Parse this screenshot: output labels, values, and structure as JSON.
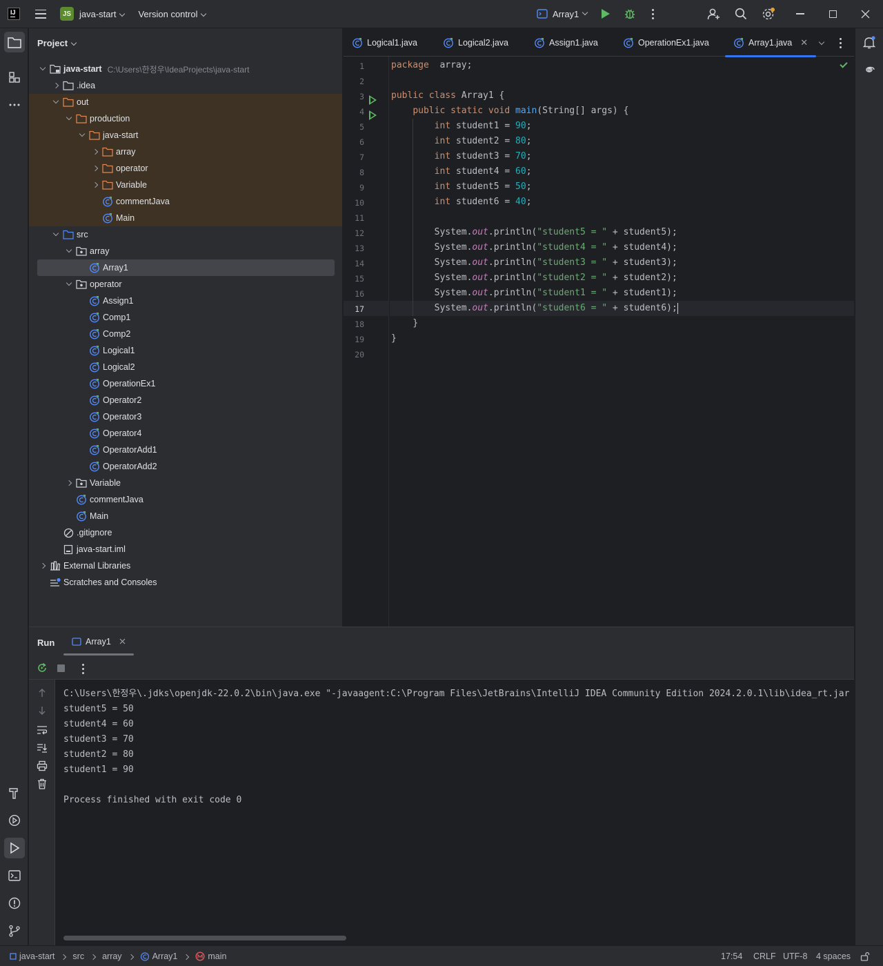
{
  "titlebar": {
    "project_badge": "JS",
    "project_name": "java-start",
    "vcs": "Version control",
    "run_config": "Array1"
  },
  "project_panel": {
    "title": "Project",
    "root_name": "java-start",
    "root_path": "C:\\Users\\한정우\\IdeaProjects\\java-start",
    "tree": [
      {
        "label": ".idea",
        "depth": 1,
        "toggle": "collapsed",
        "icon": "folder-icon"
      },
      {
        "label": "out",
        "depth": 1,
        "toggle": "expanded",
        "icon": "folder-excluded-icon"
      },
      {
        "label": "production",
        "depth": 2,
        "toggle": "expanded",
        "icon": "folder-excluded-icon"
      },
      {
        "label": "java-start",
        "depth": 3,
        "toggle": "expanded",
        "icon": "folder-excluded-icon"
      },
      {
        "label": "array",
        "depth": 4,
        "toggle": "collapsed",
        "icon": "folder-excluded-icon"
      },
      {
        "label": "operator",
        "depth": 4,
        "toggle": "collapsed",
        "icon": "folder-excluded-icon"
      },
      {
        "label": "Variable",
        "depth": 4,
        "toggle": "collapsed",
        "icon": "folder-excluded-icon"
      },
      {
        "label": "commentJava",
        "depth": 4,
        "toggle": "none",
        "icon": "java-class-icon"
      },
      {
        "label": "Main",
        "depth": 4,
        "toggle": "none",
        "icon": "java-class-icon"
      },
      {
        "label": "src",
        "depth": 1,
        "toggle": "expanded",
        "icon": "source-folder-icon"
      },
      {
        "label": "array",
        "depth": 2,
        "toggle": "expanded",
        "icon": "package-icon"
      },
      {
        "label": "Array1",
        "depth": 3,
        "toggle": "none",
        "icon": "java-class-icon",
        "selected": true
      },
      {
        "label": "operator",
        "depth": 2,
        "toggle": "expanded",
        "icon": "package-icon"
      },
      {
        "label": "Assign1",
        "depth": 3,
        "toggle": "none",
        "icon": "java-class-icon"
      },
      {
        "label": "Comp1",
        "depth": 3,
        "toggle": "none",
        "icon": "java-class-icon"
      },
      {
        "label": "Comp2",
        "depth": 3,
        "toggle": "none",
        "icon": "java-class-icon"
      },
      {
        "label": "Logical1",
        "depth": 3,
        "toggle": "none",
        "icon": "java-class-icon"
      },
      {
        "label": "Logical2",
        "depth": 3,
        "toggle": "none",
        "icon": "java-class-icon"
      },
      {
        "label": "OperationEx1",
        "depth": 3,
        "toggle": "none",
        "icon": "java-class-icon"
      },
      {
        "label": "Operator2",
        "depth": 3,
        "toggle": "none",
        "icon": "java-class-icon"
      },
      {
        "label": "Operator3",
        "depth": 3,
        "toggle": "none",
        "icon": "java-class-icon"
      },
      {
        "label": "Operator4",
        "depth": 3,
        "toggle": "none",
        "icon": "java-class-icon"
      },
      {
        "label": "OperatorAdd1",
        "depth": 3,
        "toggle": "none",
        "icon": "java-class-icon"
      },
      {
        "label": "OperatorAdd2",
        "depth": 3,
        "toggle": "none",
        "icon": "java-class-icon"
      },
      {
        "label": "Variable",
        "depth": 2,
        "toggle": "collapsed",
        "icon": "package-icon"
      },
      {
        "label": "commentJava",
        "depth": 2,
        "toggle": "none",
        "icon": "java-class-icon"
      },
      {
        "label": "Main",
        "depth": 2,
        "toggle": "none",
        "icon": "java-class-icon"
      },
      {
        "label": ".gitignore",
        "depth": 1,
        "toggle": "none",
        "icon": "ignore-file-icon"
      },
      {
        "label": "java-start.iml",
        "depth": 1,
        "toggle": "none",
        "icon": "module-file-icon"
      },
      {
        "label": "External Libraries",
        "depth": 0,
        "toggle": "collapsed",
        "icon": "library-icon"
      },
      {
        "label": "Scratches and Consoles",
        "depth": 0,
        "toggle": "none",
        "icon": "scratches-icon"
      }
    ]
  },
  "editor": {
    "tabs": [
      {
        "label": "Logical1.java",
        "active": false
      },
      {
        "label": "Logical2.java",
        "active": false
      },
      {
        "label": "Assign1.java",
        "active": false
      },
      {
        "label": "OperationEx1.java",
        "active": false
      },
      {
        "label": "Array1.java",
        "active": true
      }
    ],
    "current_line": 17,
    "line_numbers": [
      "1",
      "2",
      "3",
      "4",
      "5",
      "6",
      "7",
      "8",
      "9",
      "10",
      "11",
      "12",
      "13",
      "14",
      "15",
      "16",
      "17",
      "18",
      "19",
      "20"
    ],
    "run_markers": [
      3,
      4
    ],
    "code_lines": [
      [
        [
          "kw",
          "package"
        ],
        [
          "",
          "  array;"
        ]
      ],
      [],
      [
        [
          "kw",
          "public class "
        ],
        [
          "",
          "Array1 {"
        ]
      ],
      [
        [
          "",
          "    "
        ],
        [
          "kw",
          "public static void "
        ],
        [
          "fn",
          "main"
        ],
        [
          "",
          "(String[] args) {"
        ]
      ],
      [
        [
          "",
          "        "
        ],
        [
          "kw",
          "int "
        ],
        [
          "",
          "student1 = "
        ],
        [
          "num",
          "90"
        ],
        [
          "",
          ";"
        ]
      ],
      [
        [
          "",
          "        "
        ],
        [
          "kw",
          "int "
        ],
        [
          "",
          "student2 = "
        ],
        [
          "num",
          "80"
        ],
        [
          "",
          ";"
        ]
      ],
      [
        [
          "",
          "        "
        ],
        [
          "kw",
          "int "
        ],
        [
          "",
          "student3 = "
        ],
        [
          "num",
          "70"
        ],
        [
          "",
          ";"
        ]
      ],
      [
        [
          "",
          "        "
        ],
        [
          "kw",
          "int "
        ],
        [
          "",
          "student4 = "
        ],
        [
          "num",
          "60"
        ],
        [
          "",
          ";"
        ]
      ],
      [
        [
          "",
          "        "
        ],
        [
          "kw",
          "int "
        ],
        [
          "",
          "student5 = "
        ],
        [
          "num",
          "50"
        ],
        [
          "",
          ";"
        ]
      ],
      [
        [
          "",
          "        "
        ],
        [
          "kw",
          "int "
        ],
        [
          "",
          "student6 = "
        ],
        [
          "num",
          "40"
        ],
        [
          "",
          ";"
        ]
      ],
      [],
      [
        [
          "",
          "        System."
        ],
        [
          "fld",
          "out"
        ],
        [
          "",
          ".println("
        ],
        [
          "str",
          "\"student5 = \""
        ],
        [
          "",
          " + student5);"
        ]
      ],
      [
        [
          "",
          "        System."
        ],
        [
          "fld",
          "out"
        ],
        [
          "",
          ".println("
        ],
        [
          "str",
          "\"student4 = \""
        ],
        [
          "",
          " + student4);"
        ]
      ],
      [
        [
          "",
          "        System."
        ],
        [
          "fld",
          "out"
        ],
        [
          "",
          ".println("
        ],
        [
          "str",
          "\"student3 = \""
        ],
        [
          "",
          " + student3);"
        ]
      ],
      [
        [
          "",
          "        System."
        ],
        [
          "fld",
          "out"
        ],
        [
          "",
          ".println("
        ],
        [
          "str",
          "\"student2 = \""
        ],
        [
          "",
          " + student2);"
        ]
      ],
      [
        [
          "",
          "        System."
        ],
        [
          "fld",
          "out"
        ],
        [
          "",
          ".println("
        ],
        [
          "str",
          "\"student1 = \""
        ],
        [
          "",
          " + student1);"
        ]
      ],
      [
        [
          "",
          "        System."
        ],
        [
          "fld",
          "out"
        ],
        [
          "",
          ".println("
        ],
        [
          "str",
          "\"student6 = \""
        ],
        [
          "",
          " + student6);"
        ]
      ],
      [
        [
          "",
          "    }"
        ]
      ],
      [
        [
          "",
          "}"
        ]
      ],
      []
    ]
  },
  "run_panel": {
    "title": "Run",
    "tab_label": "Array1",
    "console_lines": [
      "C:\\Users\\한정우\\.jdks\\openjdk-22.0.2\\bin\\java.exe \"-javaagent:C:\\Program Files\\JetBrains\\IntelliJ IDEA Community Edition 2024.2.0.1\\lib\\idea_rt.jar",
      "student5 = 50",
      "student4 = 60",
      "student3 = 70",
      "student2 = 80",
      "student1 = 90",
      "",
      "Process finished with exit code 0"
    ]
  },
  "statusbar": {
    "breadcrumbs": [
      "java-start",
      "src",
      "array",
      "Array1",
      "main"
    ],
    "position": "17:54",
    "line_sep": "CRLF",
    "encoding": "UTF-8",
    "indent": "4 spaces"
  },
  "colors": {
    "accent": "#3574f0",
    "run_green": "#5fb865",
    "excluded_bg": "#3d3223",
    "keyword": "#cf8e6d",
    "number": "#2aacb8",
    "string": "#6aab73"
  }
}
